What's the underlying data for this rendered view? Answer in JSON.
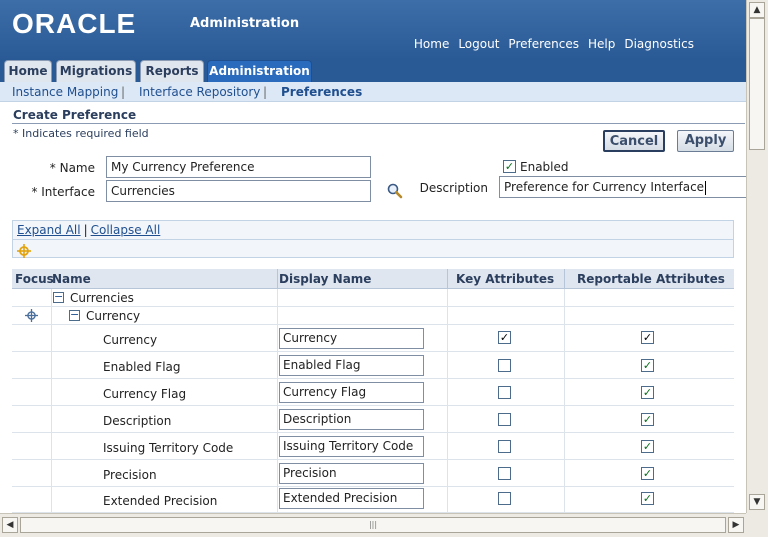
{
  "header": {
    "logo": "ORACLE",
    "app_title": "Administration",
    "global_links": [
      "Home",
      "Logout",
      "Preferences",
      "Help",
      "Diagnostics"
    ]
  },
  "tabs": [
    "Home",
    "Migrations",
    "Reports",
    "Administration"
  ],
  "active_tab": "Administration",
  "subnav": [
    "Instance Mapping",
    "Interface Repository",
    "Preferences"
  ],
  "page": {
    "title": "Create Preference",
    "required_note": "*  Indicates required field",
    "cancel_label": "Cancel",
    "apply_label": "Apply",
    "name_label": "* Name",
    "name_value": "My Currency Preference",
    "interface_label": "* Interface",
    "interface_value": "Currencies",
    "enabled_label": "Enabled",
    "enabled_checked": true,
    "description_label": "Description",
    "description_value": "Preference for Currency Interface"
  },
  "tree": {
    "expand_all": "Expand All",
    "collapse_all": "Collapse All",
    "columns": [
      "Focus",
      "Name",
      "Display Name",
      "Key Attributes",
      "Reportable Attributes"
    ],
    "root": "Currencies",
    "child": "Currency",
    "rows": [
      {
        "name": "Currency",
        "display": "Currency",
        "key": true,
        "reportable": true
      },
      {
        "name": "Enabled Flag",
        "display": "Enabled Flag",
        "key": false,
        "reportable": true
      },
      {
        "name": "Currency Flag",
        "display": "Currency Flag",
        "key": false,
        "reportable": true
      },
      {
        "name": "Description",
        "display": "Description",
        "key": false,
        "reportable": true
      },
      {
        "name": "Issuing Territory Code",
        "display": "Issuing Territory Code",
        "key": false,
        "reportable": true
      },
      {
        "name": "Precision",
        "display": "Precision",
        "key": false,
        "reportable": true
      },
      {
        "name": "Extended Precision",
        "display": "Extended Precision",
        "key": false,
        "reportable": true
      }
    ]
  }
}
